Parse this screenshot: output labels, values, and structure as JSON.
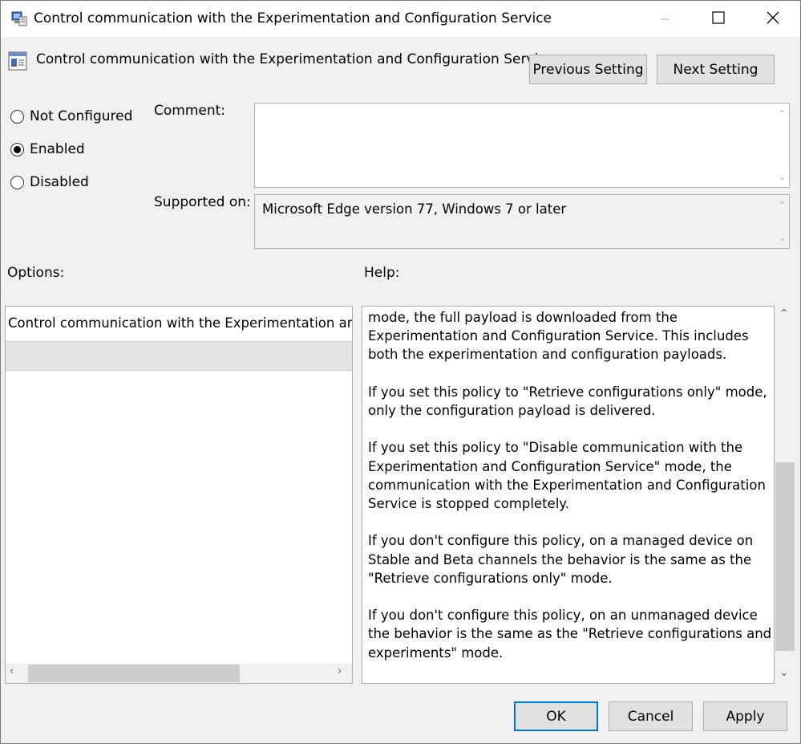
{
  "window": {
    "title": "Control communication with the Experimentation and Configuration Service"
  },
  "header": {
    "policy_name": "Control communication with the Experimentation and Configuration Service",
    "previous_label": "Previous Setting",
    "next_label": "Next Setting"
  },
  "state": {
    "options": [
      {
        "label": "Not Configured",
        "selected": false
      },
      {
        "label": "Enabled",
        "selected": true
      },
      {
        "label": "Disabled",
        "selected": false
      }
    ]
  },
  "comment": {
    "label": "Comment:",
    "value": ""
  },
  "supported": {
    "label": "Supported on:",
    "value": "Microsoft Edge version 77, Windows 7 or later"
  },
  "options_pane": {
    "label": "Options:",
    "item_text": "Control communication with the Experimentation and C"
  },
  "help_pane": {
    "label": "Help:",
    "paragraphs": [
      "mode, the full payload is downloaded from the Experimentation and Configuration Service. This includes both the experimentation and configuration payloads.",
      "If you set this policy to \"Retrieve configurations only\" mode, only the configuration payload is delivered.",
      "If you set this policy to \"Disable communication with the Experimentation and Configuration Service\" mode, the communication with the Experimentation and Configuration Service is stopped completely.",
      "If you don't configure this policy, on a managed device on Stable and Beta channels the behavior is the same as the \"Retrieve configurations only\" mode.",
      "If you don't configure this policy, on an unmanaged device the behavior is the same as the \"Retrieve configurations and experiments\" mode."
    ]
  },
  "footer": {
    "ok_label": "OK",
    "cancel_label": "Cancel",
    "apply_label": "Apply"
  }
}
